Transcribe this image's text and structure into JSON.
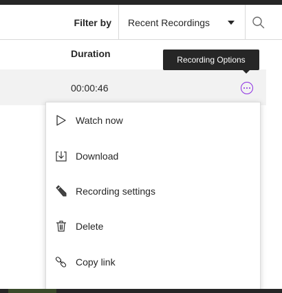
{
  "filter": {
    "label": "Filter by",
    "selected": "Recent Recordings"
  },
  "table": {
    "columns": [
      "Duration"
    ],
    "rows": [
      {
        "duration": "00:00:46"
      }
    ]
  },
  "tooltip": {
    "text": "Recording Options"
  },
  "menu": {
    "items": [
      {
        "label": "Watch now",
        "icon": "play-icon"
      },
      {
        "label": "Download",
        "icon": "download-icon"
      },
      {
        "label": "Recording settings",
        "icon": "pencil-icon"
      },
      {
        "label": "Delete",
        "icon": "trash-icon"
      },
      {
        "label": "Copy link",
        "icon": "link-icon"
      }
    ]
  },
  "colors": {
    "accent": "#8a2be2",
    "text": "#262626",
    "row_bg": "#f2f2f2"
  }
}
